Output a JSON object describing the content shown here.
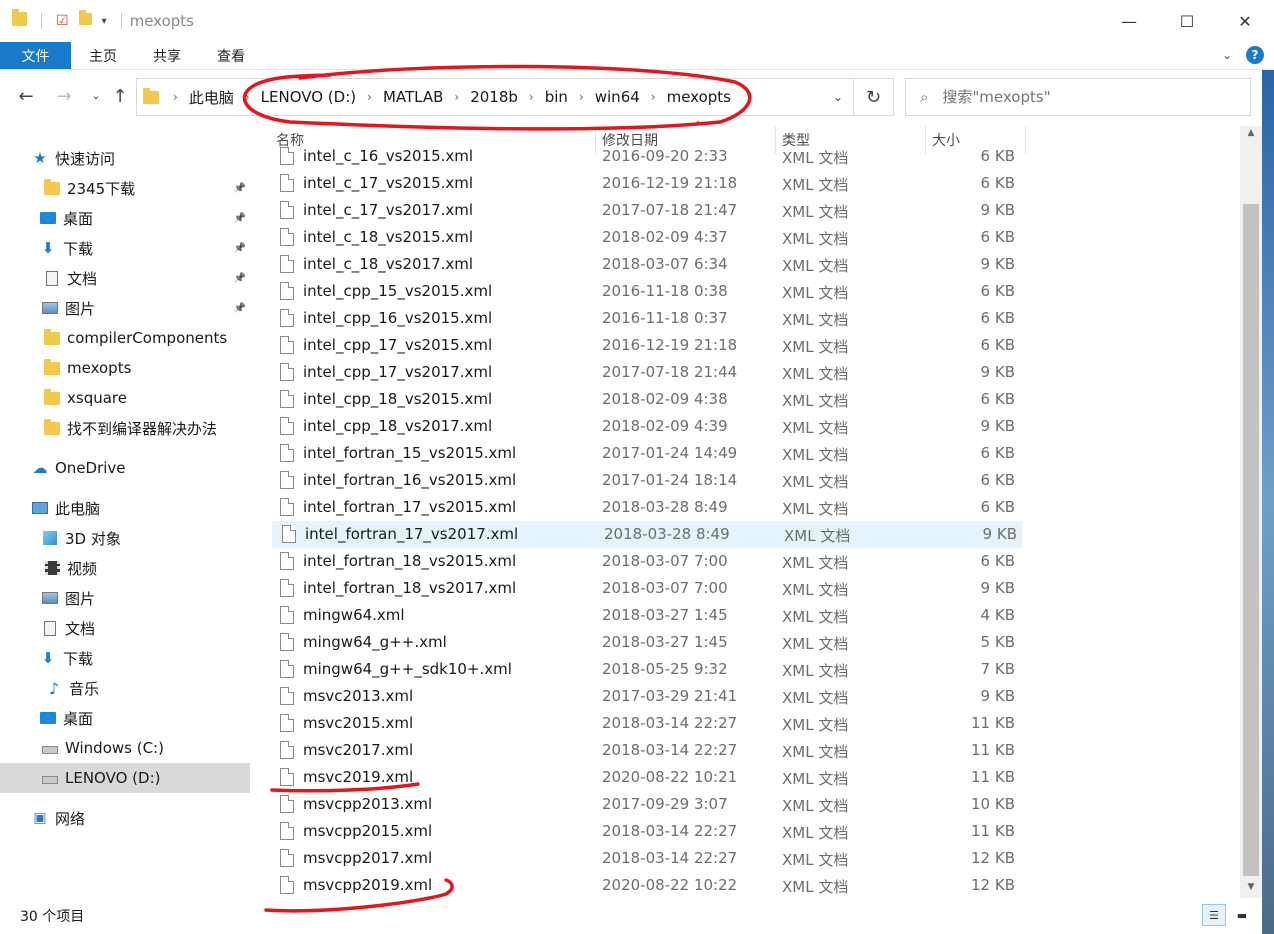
{
  "window": {
    "title": "mexopts",
    "controls": {
      "minimize": "—",
      "maximize": "☐",
      "close": "✕"
    }
  },
  "ribbon": {
    "tabs": [
      "文件",
      "主页",
      "共享",
      "查看"
    ],
    "help": "?"
  },
  "address": {
    "crumbs": [
      "此电脑",
      "LENOVO (D:)",
      "MATLAB",
      "2018b",
      "bin",
      "win64",
      "mexopts"
    ]
  },
  "search": {
    "placeholder": "搜索\"mexopts\""
  },
  "sidebar": {
    "items": [
      {
        "label": "快速访问",
        "icon": "star-icon",
        "pinned": false
      },
      {
        "label": "2345下载",
        "icon": "folder-icon",
        "pinned": true
      },
      {
        "label": "桌面",
        "icon": "desktop-icon",
        "pinned": true
      },
      {
        "label": "下载",
        "icon": "download-icon",
        "pinned": true
      },
      {
        "label": "文档",
        "icon": "document-icon",
        "pinned": true
      },
      {
        "label": "图片",
        "icon": "picture-icon",
        "pinned": true
      },
      {
        "label": "compilerComponents",
        "icon": "folder-icon",
        "pinned": false
      },
      {
        "label": "mexopts",
        "icon": "folder-icon",
        "pinned": false
      },
      {
        "label": "xsquare",
        "icon": "folder-icon",
        "pinned": false
      },
      {
        "label": "找不到编译器解决办法",
        "icon": "folder-icon",
        "pinned": false
      },
      {
        "label": "OneDrive",
        "icon": "cloud-icon",
        "pinned": false
      },
      {
        "label": "此电脑",
        "icon": "computer-icon",
        "pinned": false
      },
      {
        "label": "3D 对象",
        "icon": "cube-icon",
        "pinned": false
      },
      {
        "label": "视频",
        "icon": "video-icon",
        "pinned": false
      },
      {
        "label": "图片",
        "icon": "picture-icon",
        "pinned": false
      },
      {
        "label": "文档",
        "icon": "document-icon",
        "pinned": false
      },
      {
        "label": "下载",
        "icon": "download-icon",
        "pinned": false
      },
      {
        "label": "音乐",
        "icon": "music-icon",
        "pinned": false
      },
      {
        "label": "桌面",
        "icon": "desktop-icon",
        "pinned": false
      },
      {
        "label": "Windows (C:)",
        "icon": "drive-icon",
        "pinned": false
      },
      {
        "label": "LENOVO (D:)",
        "icon": "drive-icon",
        "pinned": false,
        "selected": true
      },
      {
        "label": "网络",
        "icon": "network-icon",
        "pinned": false
      }
    ]
  },
  "columns": {
    "name": "名称",
    "date": "修改日期",
    "type": "类型",
    "size": "大小"
  },
  "files": [
    {
      "name": "intel_c_16_vs2015.xml",
      "date": "2016-09-20 2:33",
      "type": "XML 文档",
      "size": "6 KB"
    },
    {
      "name": "intel_c_17_vs2015.xml",
      "date": "2016-12-19 21:18",
      "type": "XML 文档",
      "size": "6 KB"
    },
    {
      "name": "intel_c_17_vs2017.xml",
      "date": "2017-07-18 21:47",
      "type": "XML 文档",
      "size": "9 KB"
    },
    {
      "name": "intel_c_18_vs2015.xml",
      "date": "2018-02-09 4:37",
      "type": "XML 文档",
      "size": "6 KB"
    },
    {
      "name": "intel_c_18_vs2017.xml",
      "date": "2018-03-07 6:34",
      "type": "XML 文档",
      "size": "9 KB"
    },
    {
      "name": "intel_cpp_15_vs2015.xml",
      "date": "2016-11-18 0:38",
      "type": "XML 文档",
      "size": "6 KB"
    },
    {
      "name": "intel_cpp_16_vs2015.xml",
      "date": "2016-11-18 0:37",
      "type": "XML 文档",
      "size": "6 KB"
    },
    {
      "name": "intel_cpp_17_vs2015.xml",
      "date": "2016-12-19 21:18",
      "type": "XML 文档",
      "size": "6 KB"
    },
    {
      "name": "intel_cpp_17_vs2017.xml",
      "date": "2017-07-18 21:44",
      "type": "XML 文档",
      "size": "9 KB"
    },
    {
      "name": "intel_cpp_18_vs2015.xml",
      "date": "2018-02-09 4:38",
      "type": "XML 文档",
      "size": "6 KB"
    },
    {
      "name": "intel_cpp_18_vs2017.xml",
      "date": "2018-02-09 4:39",
      "type": "XML 文档",
      "size": "9 KB"
    },
    {
      "name": "intel_fortran_15_vs2015.xml",
      "date": "2017-01-24 14:49",
      "type": "XML 文档",
      "size": "6 KB"
    },
    {
      "name": "intel_fortran_16_vs2015.xml",
      "date": "2017-01-24 18:14",
      "type": "XML 文档",
      "size": "6 KB"
    },
    {
      "name": "intel_fortran_17_vs2015.xml",
      "date": "2018-03-28 8:49",
      "type": "XML 文档",
      "size": "6 KB"
    },
    {
      "name": "intel_fortran_17_vs2017.xml",
      "date": "2018-03-28 8:49",
      "type": "XML 文档",
      "size": "9 KB",
      "highlighted": true
    },
    {
      "name": "intel_fortran_18_vs2015.xml",
      "date": "2018-03-07 7:00",
      "type": "XML 文档",
      "size": "6 KB"
    },
    {
      "name": "intel_fortran_18_vs2017.xml",
      "date": "2018-03-07 7:00",
      "type": "XML 文档",
      "size": "9 KB"
    },
    {
      "name": "mingw64.xml",
      "date": "2018-03-27 1:45",
      "type": "XML 文档",
      "size": "4 KB"
    },
    {
      "name": "mingw64_g++.xml",
      "date": "2018-03-27 1:45",
      "type": "XML 文档",
      "size": "5 KB"
    },
    {
      "name": "mingw64_g++_sdk10+.xml",
      "date": "2018-05-25 9:32",
      "type": "XML 文档",
      "size": "7 KB"
    },
    {
      "name": "msvc2013.xml",
      "date": "2017-03-29 21:41",
      "type": "XML 文档",
      "size": "9 KB"
    },
    {
      "name": "msvc2015.xml",
      "date": "2018-03-14 22:27",
      "type": "XML 文档",
      "size": "11 KB"
    },
    {
      "name": "msvc2017.xml",
      "date": "2018-03-14 22:27",
      "type": "XML 文档",
      "size": "11 KB"
    },
    {
      "name": "msvc2019.xml",
      "date": "2020-08-22 10:21",
      "type": "XML 文档",
      "size": "11 KB"
    },
    {
      "name": "msvcpp2013.xml",
      "date": "2017-09-29 3:07",
      "type": "XML 文档",
      "size": "10 KB"
    },
    {
      "name": "msvcpp2015.xml",
      "date": "2018-03-14 22:27",
      "type": "XML 文档",
      "size": "11 KB"
    },
    {
      "name": "msvcpp2017.xml",
      "date": "2018-03-14 22:27",
      "type": "XML 文档",
      "size": "12 KB"
    },
    {
      "name": "msvcpp2019.xml",
      "date": "2020-08-22 10:22",
      "type": "XML 文档",
      "size": "12 KB"
    }
  ],
  "status": {
    "count": "30 个项目"
  },
  "colors": {
    "accent": "#1979ca",
    "annotation": "#e8141c",
    "highlight_row": "#e5f3ff",
    "selected_sidebar": "#d9d9d9"
  }
}
